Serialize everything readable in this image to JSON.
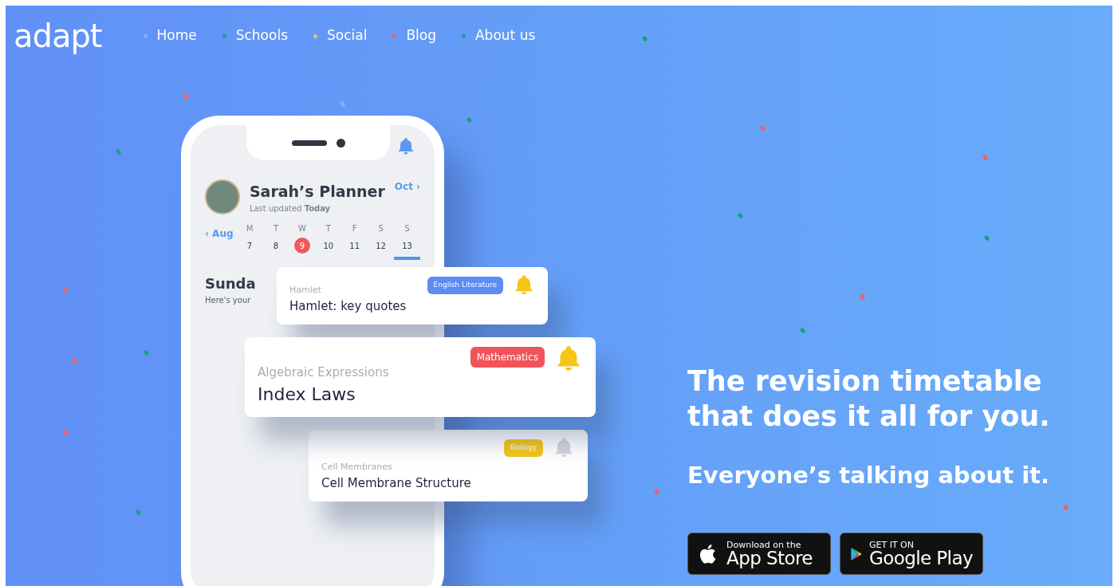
{
  "logo": "adapt",
  "nav": [
    {
      "label": "Home",
      "color": "#7eb4f8"
    },
    {
      "label": "Schools",
      "color": "#1aa07a"
    },
    {
      "label": "Social",
      "color": "#e8c46a"
    },
    {
      "label": "Blog",
      "color": "#f0625e"
    },
    {
      "label": "About us",
      "color": "#1aa07a"
    }
  ],
  "planner": {
    "title": "Sarah’s Planner",
    "subtitle": "Last updated **Today**",
    "prev_month": "‹ Aug",
    "next_month": "Oct ›",
    "days": [
      {
        "letter": "M",
        "date": "7",
        "today": false,
        "selected": false
      },
      {
        "letter": "T",
        "date": "8",
        "today": false,
        "selected": false
      },
      {
        "letter": "W",
        "date": "9",
        "today": true,
        "selected": false
      },
      {
        "letter": "T",
        "date": "10",
        "today": false,
        "selected": false
      },
      {
        "letter": "F",
        "date": "11",
        "today": false,
        "selected": false
      },
      {
        "letter": "S",
        "date": "12",
        "today": false,
        "selected": false
      },
      {
        "letter": "S",
        "date": "13",
        "today": false,
        "selected": true
      }
    ],
    "day_heading": "Sunda",
    "day_note": "Here's your",
    "cards": [
      {
        "topic": "Hamlet",
        "title": "Hamlet: key quotes",
        "tag": "English Literature",
        "color": "#5b8cf2",
        "bell_on": true
      },
      {
        "topic": "Algebraic Expressions",
        "title": "Index Laws",
        "tag": "Mathematics",
        "color": "#f0545a",
        "bell_on": true
      },
      {
        "topic": "Cell Membranes",
        "title": "Cell Membrane Structure",
        "tag": "Biology",
        "color": "#f5c518",
        "bell_on": false
      }
    ]
  },
  "headline": "The revision timetable that does it all for you.",
  "tagline": "Everyone’s talking about it.",
  "stores": [
    {
      "kind": "apple",
      "small": "Download on the",
      "big": "App Store"
    },
    {
      "kind": "google",
      "small": "GET IT ON",
      "big": "Google Play"
    }
  ]
}
